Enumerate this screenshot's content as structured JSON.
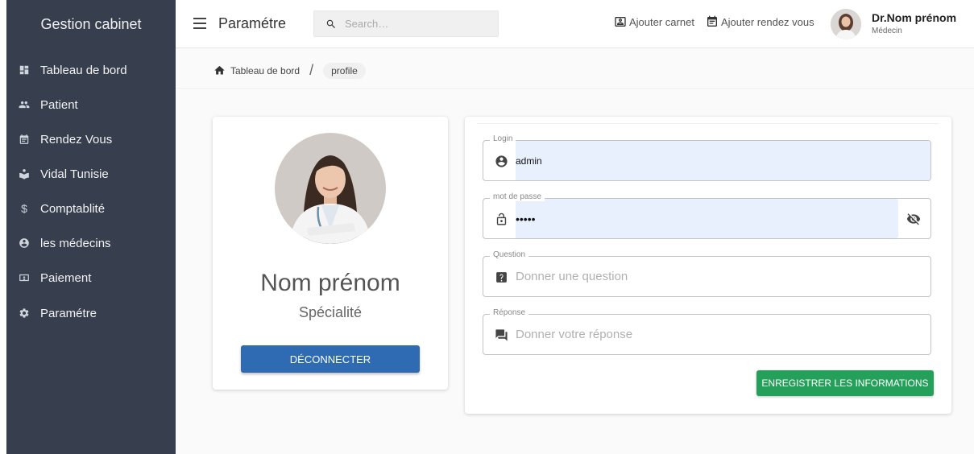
{
  "sidebar": {
    "brand": "Gestion cabinet",
    "items": [
      {
        "label": "Tableau de bord",
        "icon": "dashboard-icon"
      },
      {
        "label": "Patient",
        "icon": "people-icon"
      },
      {
        "label": "Rendez Vous",
        "icon": "calendar-icon"
      },
      {
        "label": "Vidal Tunisie",
        "icon": "reader-icon"
      },
      {
        "label": "Comptablité",
        "icon": "dollar-icon"
      },
      {
        "label": "les médecins",
        "icon": "account-circle-icon"
      },
      {
        "label": "Paiement",
        "icon": "money-icon"
      },
      {
        "label": "Paramétre",
        "icon": "gear-icon"
      }
    ]
  },
  "header": {
    "title": "Paramétre",
    "search_placeholder": "Search…",
    "add_carnet": "Ajouter carnet",
    "add_appointment": "Ajouter rendez vous",
    "user_name": "Dr.Nom prénom",
    "user_role": "Médecin"
  },
  "breadcrumb": {
    "home": "Tableau de bord",
    "separator": "/",
    "current": "profile"
  },
  "profile": {
    "name": "Nom prénom",
    "specialty": "Spécialité",
    "logout_label": "DÉCONNECTER"
  },
  "form": {
    "login_label": "Login",
    "login_value": "admin",
    "password_label": "mot de passe",
    "password_value": "•••••",
    "question_label": "Question",
    "question_placeholder": "Donner une question",
    "answer_label": "Réponse",
    "answer_placeholder": "Donner votre réponse",
    "save_label": "ENREGISTRER LES INFORMATIONS"
  },
  "colors": {
    "sidebar_bg": "#373f4f",
    "logout_button": "#2f6bb3",
    "save_button": "#25a05a",
    "autofill_bg": "#e8f0fe"
  }
}
